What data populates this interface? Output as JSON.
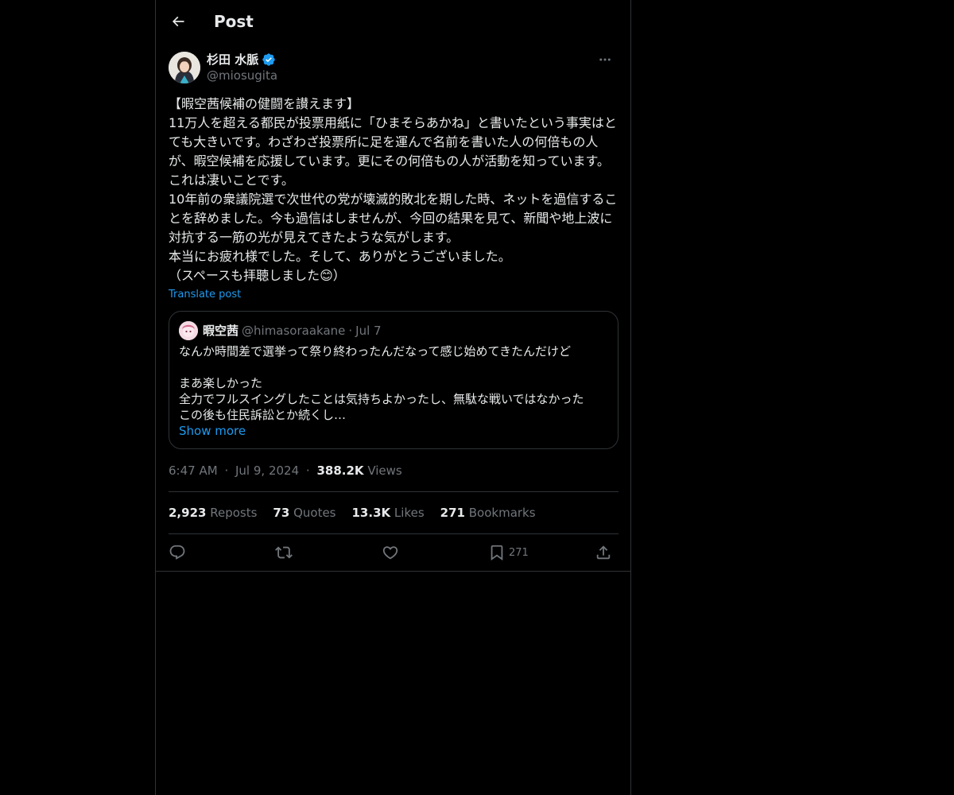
{
  "header": {
    "title": "Post"
  },
  "author": {
    "name": "杉田 水脈",
    "handle": "@miosugita"
  },
  "post": {
    "text": "【暇空茜候補の健闘を讃えます】\n11万人を超える都民が投票用紙に「ひまそらあかね」と書いたという事実はとても大きいです。わざわざ投票所に足を運んで名前を書いた人の何倍もの人が、暇空候補を応援しています。更にその何倍もの人が活動を知っています。これは凄いことです。\n10年前の衆議院選で次世代の党が壊滅的敗北を期した時、ネットを過信することを辞めました。今も過信はしませんが、今回の結果を見て、新聞や地上波に対抗する一筋の光が見えてきたような気がします。\n本当にお疲れ様でした。そして、ありがとうございました。\n（スペースも拝聴しました😊）",
    "translate_label": "Translate post"
  },
  "quote": {
    "name": "暇空茜",
    "handle": "@himasoraakane",
    "dot": "·",
    "date": "Jul 7",
    "text": "なんか時間差で選挙って祭り終わったんだなって感じ始めてきたんだけど\n\nまあ楽しかった\n全力でフルスイングしたことは気持ちよかったし、無駄な戦いではなかった\nこの後も住民訴訟とか続くし…",
    "show_more": "Show more"
  },
  "meta": {
    "time": "6:47 AM",
    "sep1": "·",
    "date": "Jul 9, 2024",
    "sep2": "·",
    "views_count": "388.2K",
    "views_label": "Views"
  },
  "stats": {
    "reposts_count": "2,923",
    "reposts_label": "Reposts",
    "quotes_count": "73",
    "quotes_label": "Quotes",
    "likes_count": "13.3K",
    "likes_label": "Likes",
    "bookmarks_count": "271",
    "bookmarks_label": "Bookmarks"
  },
  "actions": {
    "bookmark_count": "271"
  },
  "colors": {
    "background": "#000000",
    "text": "#e7e9ea",
    "muted": "#71767b",
    "accent": "#1d9bf0",
    "border": "#2f3336"
  }
}
